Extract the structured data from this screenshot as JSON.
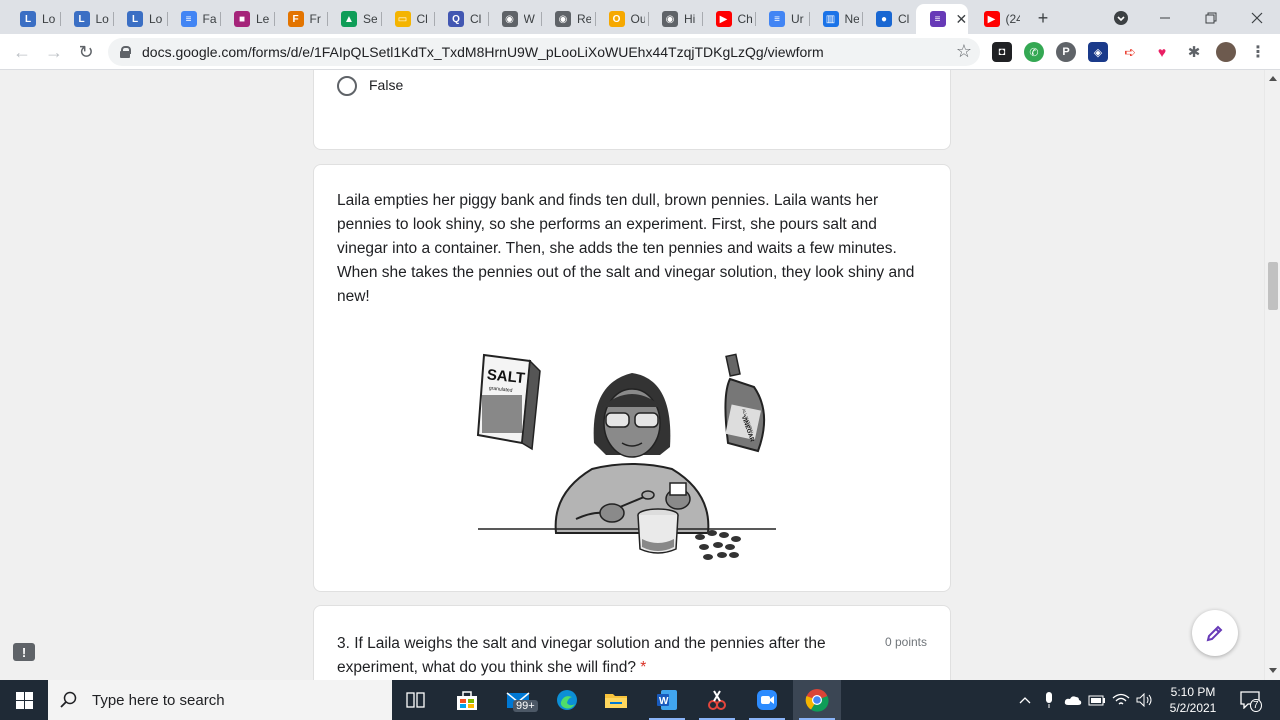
{
  "browser": {
    "tabs": [
      {
        "title": "Lo",
        "icon": "lo-icon",
        "color": "#3b6fc4",
        "glyph": "L"
      },
      {
        "title": "Lo",
        "icon": "lo-icon",
        "color": "#3b6fc4",
        "glyph": "L"
      },
      {
        "title": "Lo",
        "icon": "lo-icon",
        "color": "#3b6fc4",
        "glyph": "L"
      },
      {
        "title": "Fa",
        "icon": "docs-icon",
        "color": "#4285f4",
        "glyph": "≡"
      },
      {
        "title": "Le",
        "icon": "lesson-icon",
        "color": "#a5247a",
        "glyph": "■"
      },
      {
        "title": "Fr",
        "icon": "fox-icon",
        "color": "#e37400",
        "glyph": "F"
      },
      {
        "title": "Se",
        "icon": "drive-icon",
        "color": "#0f9d58",
        "glyph": "▲"
      },
      {
        "title": "Cl",
        "icon": "slides-icon",
        "color": "#f4b400",
        "glyph": "▭"
      },
      {
        "title": "Cl",
        "icon": "quizlet-icon",
        "color": "#4257b2",
        "glyph": "Q"
      },
      {
        "title": "W",
        "icon": "globe-icon",
        "color": "#5f6368",
        "glyph": "◉"
      },
      {
        "title": "Re",
        "icon": "globe-icon",
        "color": "#5f6368",
        "glyph": "◉"
      },
      {
        "title": "Ou",
        "icon": "o-icon",
        "color": "#f6a800",
        "glyph": "O"
      },
      {
        "title": "Hi",
        "icon": "earth-icon",
        "color": "#5f6368",
        "glyph": "◉"
      },
      {
        "title": "Ch",
        "icon": "youtube-icon",
        "color": "#ff0000",
        "glyph": "▶"
      },
      {
        "title": "Ur",
        "icon": "docs-icon",
        "color": "#4285f4",
        "glyph": "≡"
      },
      {
        "title": "Ne",
        "icon": "book-icon",
        "color": "#1a73e8",
        "glyph": "▥"
      },
      {
        "title": "Cl",
        "icon": "classroom-icon",
        "color": "#1967d2",
        "glyph": "●"
      },
      {
        "title": "",
        "icon": "forms-icon",
        "color": "#673ab7",
        "glyph": "≡",
        "active": true
      },
      {
        "title": "(24",
        "icon": "youtube-icon",
        "color": "#ff0000",
        "glyph": "▶"
      }
    ],
    "new_tab": "+",
    "url": "docs.google.com/forms/d/e/1FAIpQLSetl1KdTx_TxdM8HrnU9W_pLooLiXoWUEhx44TzqjTDKgLzQg/viewform"
  },
  "form": {
    "prev_option": "False",
    "story": "Laila empties her piggy bank and finds ten dull, brown pennies. Laila wants her pennies to look shiny, so she performs an experiment. First, she pours salt and vinegar into a container. Then, she adds the ten pennies and waits a few minutes. When she takes the pennies out of the salt and vinegar solution, they look shiny and new!",
    "illustration": {
      "salt_label": "SALT",
      "salt_sub": "granulated",
      "vinegar_top": "ALL NATURAL",
      "vinegar_label": "VINEGAR"
    },
    "question3": {
      "text": "3. If Laila weighs the salt and vinegar solution and the pennies after the experiment, what do you think she will find?",
      "required": "*",
      "points": "0 points"
    }
  },
  "taskbar": {
    "search_placeholder": "Type here to search",
    "mail_badge": "99+",
    "time": "5:10 PM",
    "date": "5/2/2021",
    "notifications": "7"
  },
  "colors": {
    "accent": "#673ab7",
    "taskbar": "#1f2a36",
    "required": "#d93025"
  }
}
